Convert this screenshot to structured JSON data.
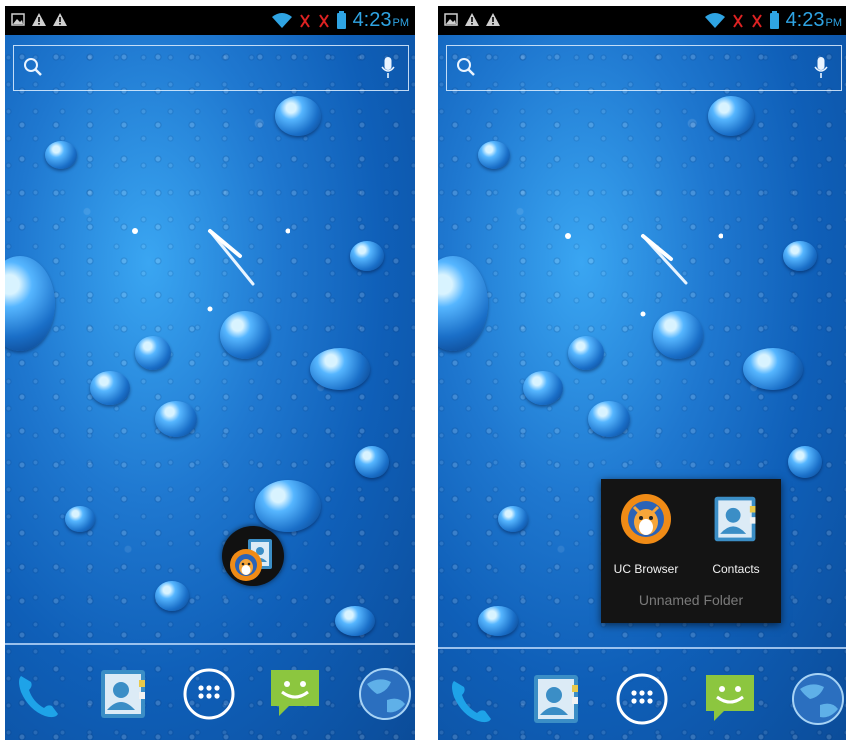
{
  "status_bar": {
    "time": "4:23",
    "ampm": "PM",
    "icons": [
      "picture-notification-icon",
      "warning-icon",
      "warning-icon",
      "wifi-icon",
      "no-signal-icon",
      "no-signal-icon",
      "battery-icon"
    ]
  },
  "search_bar": {
    "icons": [
      "search-icon",
      "mic-icon"
    ]
  },
  "dock": {
    "icons": [
      "phone-icon",
      "contacts-icon",
      "app-drawer-icon",
      "messaging-icon",
      "browser-globe-icon"
    ]
  },
  "folder": {
    "title": "Unnamed Folder",
    "apps": [
      {
        "label": "UC Browser",
        "icon": "uc-browser-icon"
      },
      {
        "label": "Contacts",
        "icon": "contacts-icon"
      }
    ]
  },
  "colors": {
    "status_accent": "#2fa4e3",
    "wallpaper": "#1f78d0",
    "folder_bg": "#141414"
  }
}
